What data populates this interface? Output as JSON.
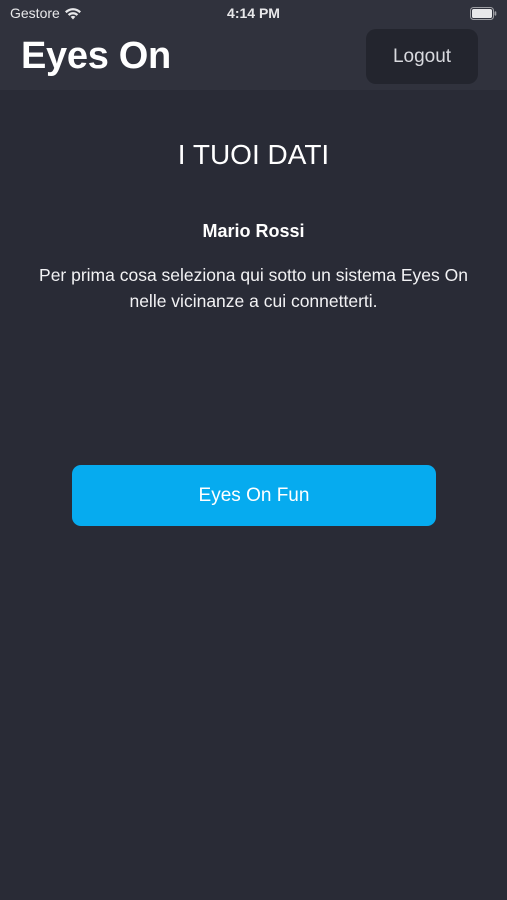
{
  "status_bar": {
    "carrier": "Gestore",
    "time": "4:14 PM",
    "wifi_icon": "wifi-icon",
    "battery_icon": "battery-icon"
  },
  "header": {
    "title": "Eyes On",
    "logout_label": "Logout"
  },
  "main": {
    "section_title": "I TUOI DATI",
    "user_name": "Mario Rossi",
    "instructions": "Per prima cosa seleziona qui sotto un sistema Eyes On nelle vicinanze a cui connetterti.",
    "devices": [
      {
        "label": "Eyes On Fun"
      }
    ]
  },
  "colors": {
    "background": "#292b36",
    "header": "#30323d",
    "accent": "#06abef",
    "logout_button": "#23252e"
  }
}
